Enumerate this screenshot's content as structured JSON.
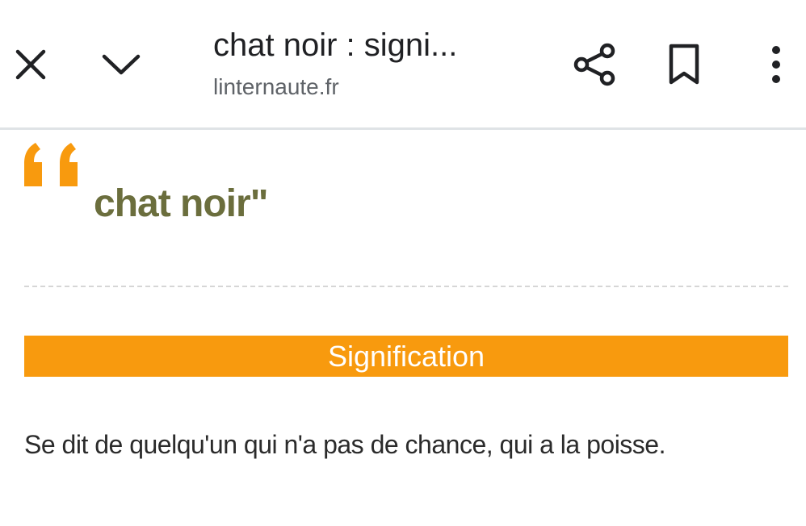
{
  "toolbar": {
    "page_title": "chat noir : signi...",
    "domain": "linternaute.fr",
    "icons": {
      "close": "close-icon",
      "collapse": "chevron-down-icon",
      "share": "share-icon",
      "bookmark": "bookmark-icon",
      "more": "more-vert-icon"
    }
  },
  "article": {
    "expression": "chat noir\"",
    "section_heading": "Signification",
    "definition": "Se dit de quelqu'un qui n'a pas de chance, qui a la poisse."
  },
  "colors": {
    "accent_orange": "#f89a0e",
    "expression_olive": "#6b6e3d",
    "text_dark": "#2b2b2b"
  }
}
